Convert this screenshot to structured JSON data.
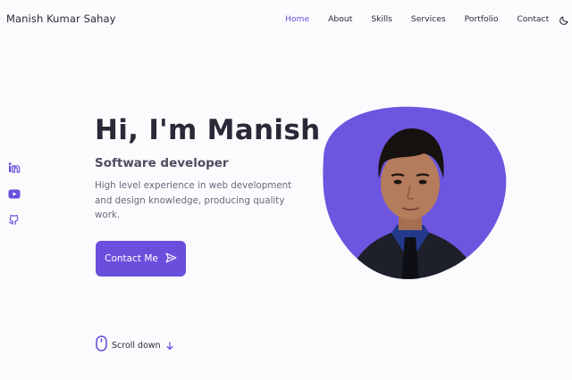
{
  "header": {
    "brand": "Manish Kumar Sahay",
    "nav": [
      "Home",
      "About",
      "Skills",
      "Services",
      "Portfolio",
      "Contact"
    ],
    "active_nav": "Home",
    "theme_toggle_icon": "moon-icon"
  },
  "social": [
    {
      "icon": "linkedin-icon"
    },
    {
      "icon": "youtube-icon"
    },
    {
      "icon": "github-icon"
    }
  ],
  "hero": {
    "title": "Hi, I'm Manish",
    "subtitle": "Software developer",
    "description": "High level experience in web development and design knowledge, producing quality work.",
    "cta_label": "Contact Me",
    "cta_icon": "send-icon",
    "image_subject": "profile-photo"
  },
  "scroll": {
    "label": "Scroll down",
    "mouse_icon": "mouse-icon",
    "arrow_icon": "arrow-down-icon"
  },
  "colors": {
    "accent": "#6a4fdd",
    "background": "#fbfbfe",
    "title": "#2b2937",
    "text": "#6b6879"
  }
}
